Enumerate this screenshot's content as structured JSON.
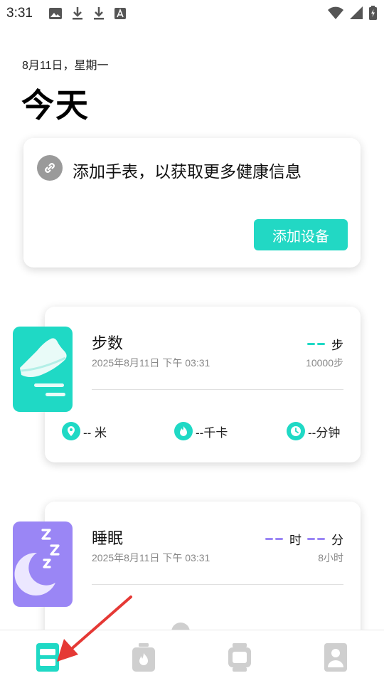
{
  "status_bar": {
    "time": "3:31",
    "left_icons": [
      "image-icon",
      "download-icon",
      "download-icon",
      "font-icon"
    ],
    "right_icons": [
      "wifi-icon",
      "signal-icon",
      "battery-icon"
    ]
  },
  "header": {
    "date": "8月11日，星期一",
    "title": "今天"
  },
  "device_card": {
    "icon": "link-icon",
    "text": "添加手表，以获取更多健康信息",
    "button_label": "添加设备",
    "accent": "#22d8c4"
  },
  "steps_card": {
    "title": "步数",
    "date": "2025年8月11日 下午 03:31",
    "value_unit": "步",
    "goal": "10000步",
    "distance": "-- 米",
    "calories": "--千卡",
    "duration": "--分钟",
    "accent": "#1fd9c5"
  },
  "sleep_card": {
    "title": "睡眠",
    "date": "2025年8月11日 下午 03:31",
    "hour_unit": "时",
    "minute_unit": "分",
    "goal": "8小时",
    "accent": "#9a86f5"
  },
  "tabbar": {
    "active": "tab-today",
    "items": [
      "today-icon",
      "fitness-icon",
      "watch-icon",
      "profile-icon"
    ]
  },
  "annotation": {
    "arrow_color": "#e53935"
  }
}
